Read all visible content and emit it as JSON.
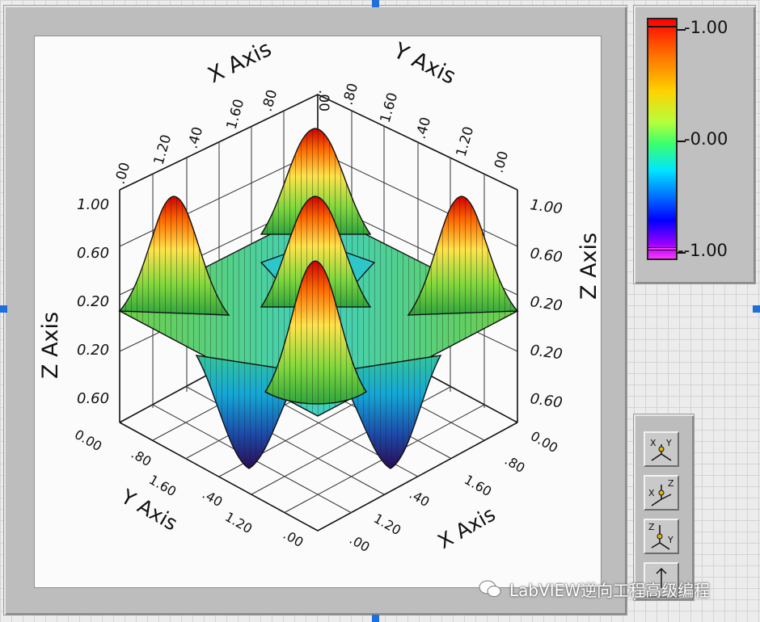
{
  "graph": {
    "x_axis_label": "X Axis",
    "y_axis_label": "Y Axis",
    "z_axis_label": "Z Axis",
    "x_ticks": [
      ".00",
      ".40",
      ".80",
      "1.20",
      "1.60",
      "2.00"
    ],
    "y_ticks": [
      ".00",
      ".40",
      ".80",
      "1.20",
      "1.60",
      "2.00"
    ],
    "z_ticks": [
      "1.00",
      "0.60",
      "0.20",
      "0.20",
      "0.60"
    ]
  },
  "colormap_legend": {
    "labels": [
      "-1.00",
      "-0.00",
      "--1.00"
    ],
    "colors": [
      "#ff0000",
      "#ff6a00",
      "#ffd200",
      "#b6ff3c",
      "#3cff6c",
      "#00e6ff",
      "#0070ff",
      "#0000ff",
      "#9900ff",
      "#ff33ff"
    ]
  },
  "toolbar": {
    "buttons": [
      "xy-plane-icon",
      "xz-plane-icon",
      "zy-plane-icon",
      "reset-view-icon"
    ]
  },
  "watermark": {
    "text": "LabVIEW逆向工程高级编程"
  }
}
